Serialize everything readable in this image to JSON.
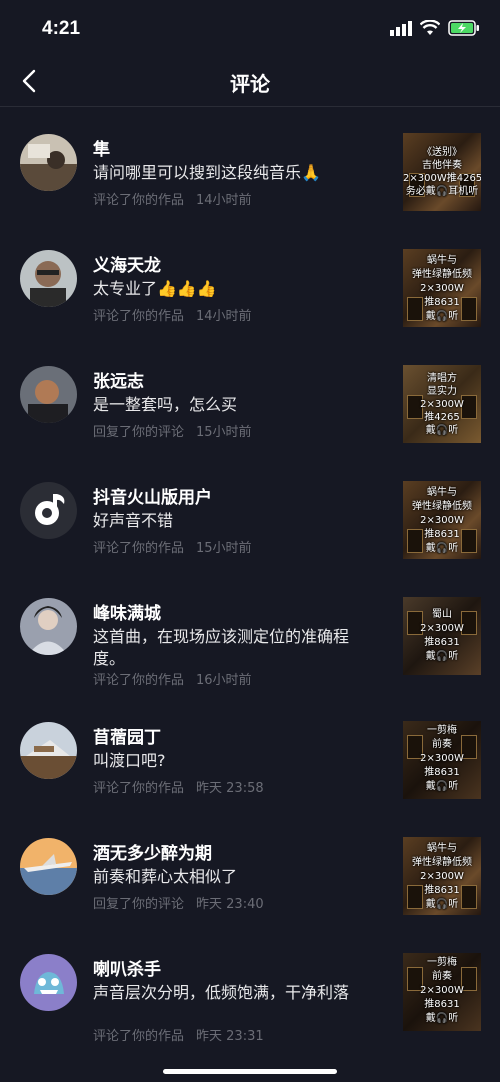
{
  "status": {
    "time": "4:21"
  },
  "header": {
    "title": "评论"
  },
  "comments": [
    {
      "name": "隼",
      "text": "请问哪里可以搜到这段纯音乐🙏",
      "action": "评论了你的作品",
      "time": "14小时前",
      "thumb": [
        "《送别》",
        "吉他伴奏",
        "2×300W推4265",
        "务必戴🎧耳机听"
      ]
    },
    {
      "name": "义海天龙",
      "text": "太专业了👍👍👍",
      "action": "评论了你的作品",
      "time": "14小时前",
      "thumb": [
        "蜗牛与",
        "弹性绿静低频",
        "2×300W",
        "推8631",
        "戴🎧听"
      ]
    },
    {
      "name": "张远志",
      "text": "是一整套吗，怎么买",
      "action": "回复了你的评论",
      "time": "15小时前",
      "thumb": [
        "清唱方",
        "显实力",
        "2×300W",
        "推4265",
        "戴🎧听"
      ]
    },
    {
      "name": "抖音火山版用户",
      "text": "好声音不错",
      "action": "评论了你的作品",
      "time": "15小时前",
      "thumb": [
        "蜗牛与",
        "弹性绿静低频",
        "2×300W",
        "推8631",
        "戴🎧听"
      ]
    },
    {
      "name": "峰味满城",
      "text": "这首曲，在现场应该测定位的准确程度。",
      "action": "评论了你的作品",
      "time": "16小时前",
      "thumb": [
        "蜀山",
        "2×300W",
        "推8631",
        "戴🎧听"
      ]
    },
    {
      "name": "苜蓿园丁",
      "text": "叫渡口吧?",
      "action": "评论了你的作品",
      "time": "昨天 23:58",
      "thumb": [
        "一剪梅",
        "前奏",
        "2×300W",
        "推8631",
        "戴🎧听"
      ]
    },
    {
      "name": "酒无多少醉为期",
      "text": "前奏和葬心太相似了",
      "action": "回复了你的评论",
      "time": "昨天 23:40",
      "thumb": [
        "蜗牛与",
        "弹性绿静低频",
        "2×300W",
        "推8631",
        "戴🎧听"
      ]
    },
    {
      "name": "喇叭杀手",
      "text": "声音层次分明，低频饱满，干净利落",
      "action": "评论了你的作品",
      "time": "昨天 23:31",
      "thumb": [
        "一剪梅",
        "前奏",
        "2×300W",
        "推8631",
        "戴🎧听"
      ]
    }
  ]
}
